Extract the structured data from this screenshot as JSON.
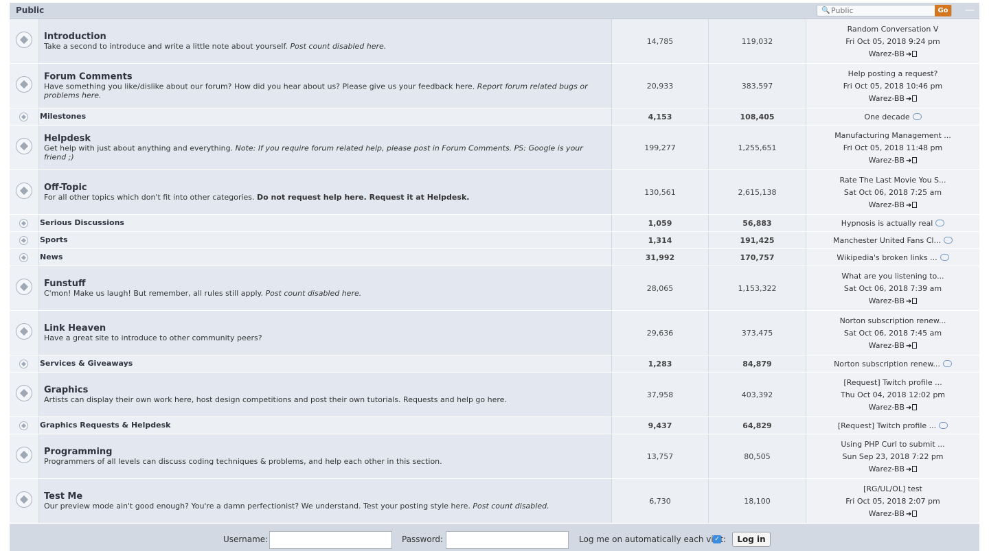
{
  "category": {
    "title": "Public"
  },
  "jump": {
    "placeholder": "Public",
    "go_label": "Go",
    "collapse_glyph": "—"
  },
  "forums": [
    {
      "kind": "big",
      "title": "Introduction",
      "desc_html": "Take a second to introduce and write a little note about yourself. <i>Post count disabled here.</i>",
      "topics": "14,785",
      "posts": "119,032",
      "last_title": "Random Conversation V",
      "last_date": "Fri Oct 05, 2018 9:24 pm",
      "last_user": "Warez-BB"
    },
    {
      "kind": "big",
      "title": "Forum Comments",
      "desc_html": "Have something you like/dislike about our forum? How did you hear about us? Please give us your feedback here. <i>Report forum related bugs or problems here.</i>",
      "topics": "20,933",
      "posts": "383,597",
      "last_title": "Help posting a request?",
      "last_date": "Fri Oct 05, 2018 10:46 pm",
      "last_user": "Warez-BB"
    },
    {
      "kind": "small",
      "title": "Milestones",
      "topics": "4,153",
      "posts": "108,405",
      "last_title": "One decade"
    },
    {
      "kind": "big",
      "title": "Helpdesk",
      "desc_html": "Get help with just about anything and everything. <i>Note: If you require forum related help, please post in Forum Comments. PS: Google is your friend ;)</i>",
      "topics": "199,277",
      "posts": "1,255,651",
      "last_title": "Manufacturing Management ...",
      "last_date": "Fri Oct 05, 2018 11:48 pm",
      "last_user": "Warez-BB"
    },
    {
      "kind": "big",
      "title": "Off-Topic",
      "desc_html": "For all other topics which don't fit into other categories. <b>Do not request help here. Request it at Helpdesk.</b>",
      "topics": "130,561",
      "posts": "2,615,138",
      "last_title": "Rate The Last Movie You S...",
      "last_date": "Sat Oct 06, 2018 7:25 am",
      "last_user": "Warez-BB"
    },
    {
      "kind": "small",
      "title": "Serious Discussions",
      "topics": "1,059",
      "posts": "56,883",
      "last_title": "Hypnosis is actually real"
    },
    {
      "kind": "small",
      "title": "Sports",
      "topics": "1,314",
      "posts": "191,425",
      "last_title": "Manchester United Fans Cl..."
    },
    {
      "kind": "small",
      "title": "News",
      "topics": "31,992",
      "posts": "170,757",
      "last_title": "Wikipedia's broken links ..."
    },
    {
      "kind": "big",
      "title": "Funstuff",
      "desc_html": "C'mon! Make us laugh! But remember, all rules still apply. <i>Post count disabled here.</i>",
      "topics": "28,065",
      "posts": "1,153,322",
      "last_title": "What are you listening to...",
      "last_date": "Sat Oct 06, 2018 7:39 am",
      "last_user": "Warez-BB"
    },
    {
      "kind": "big",
      "title": "Link Heaven",
      "desc_html": "Have a great site to introduce to other community peers?",
      "topics": "29,636",
      "posts": "373,475",
      "last_title": "Norton subscription renew...",
      "last_date": "Sat Oct 06, 2018 7:45 am",
      "last_user": "Warez-BB"
    },
    {
      "kind": "small",
      "title": "Services & Giveaways",
      "topics": "1,283",
      "posts": "84,879",
      "last_title": "Norton subscription renew..."
    },
    {
      "kind": "big",
      "title": "Graphics",
      "desc_html": "Artists can display their own work here, host design competitions and post their own tutorials. Requests and help go here.",
      "topics": "37,958",
      "posts": "403,392",
      "last_title": "[Request] Twitch profile ...",
      "last_date": "Thu Oct 04, 2018 12:02 pm",
      "last_user": "Warez-BB"
    },
    {
      "kind": "small",
      "title": "Graphics Requests & Helpdesk",
      "topics": "9,437",
      "posts": "64,829",
      "last_title": "[Request] Twitch profile ..."
    },
    {
      "kind": "big",
      "title": "Programming",
      "desc_html": "Programmers of all levels can discuss coding techniques & problems, and help each other in this section.",
      "topics": "13,757",
      "posts": "80,505",
      "last_title": "Using PHP Curl to submit ...",
      "last_date": "Sun Sep 23, 2018 7:22 pm",
      "last_user": "Warez-BB"
    },
    {
      "kind": "big",
      "title": "Test Me",
      "desc_html": "Our preview mode ain't good enough? You're a damn perfectionist? We understand. Test your posting style here. <i>Post count disabled.</i>",
      "topics": "6,730",
      "posts": "18,100",
      "last_title": "[RG/UL/OL] test",
      "last_date": "Fri Oct 05, 2018 2:07 pm",
      "last_user": "Warez-BB"
    }
  ],
  "login": {
    "username_label": "Username:",
    "password_label": "Password:",
    "auto_label": "Log me on automatically each visit:",
    "auto_checked": true,
    "button_label": "Log in",
    "check_glyph": "✓"
  }
}
